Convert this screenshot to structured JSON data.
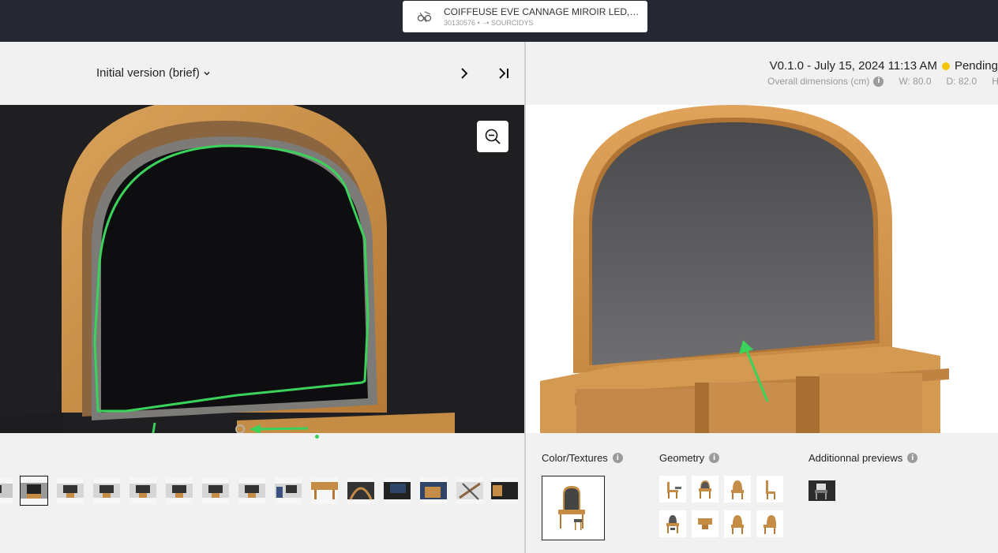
{
  "header": {
    "product_name": "COIFFEUSE EVE CANNAGE MIROIR LED, 2 TIR...",
    "product_id": "30130576",
    "brand": "SOURCIDYS"
  },
  "left_panel": {
    "version_selector": "Initial version (brief)",
    "thumbnail_count": 15
  },
  "right_panel": {
    "version_line": "V0.1.0 - July 15, 2024 11:13 AM",
    "status": "Pending",
    "status_color": "#f2c500",
    "dimensions_label": "Overall dimensions (cm)",
    "dim_w": "W: 80.0",
    "dim_d": "D: 82.0",
    "dim_h": "H:",
    "sections": {
      "color_textures": "Color/Textures",
      "geometry": "Geometry",
      "additional": "Additionnal previews"
    }
  },
  "colors": {
    "annotation_green": "#3ad25a",
    "topbar": "#252833",
    "wood": "#d39a4e"
  }
}
